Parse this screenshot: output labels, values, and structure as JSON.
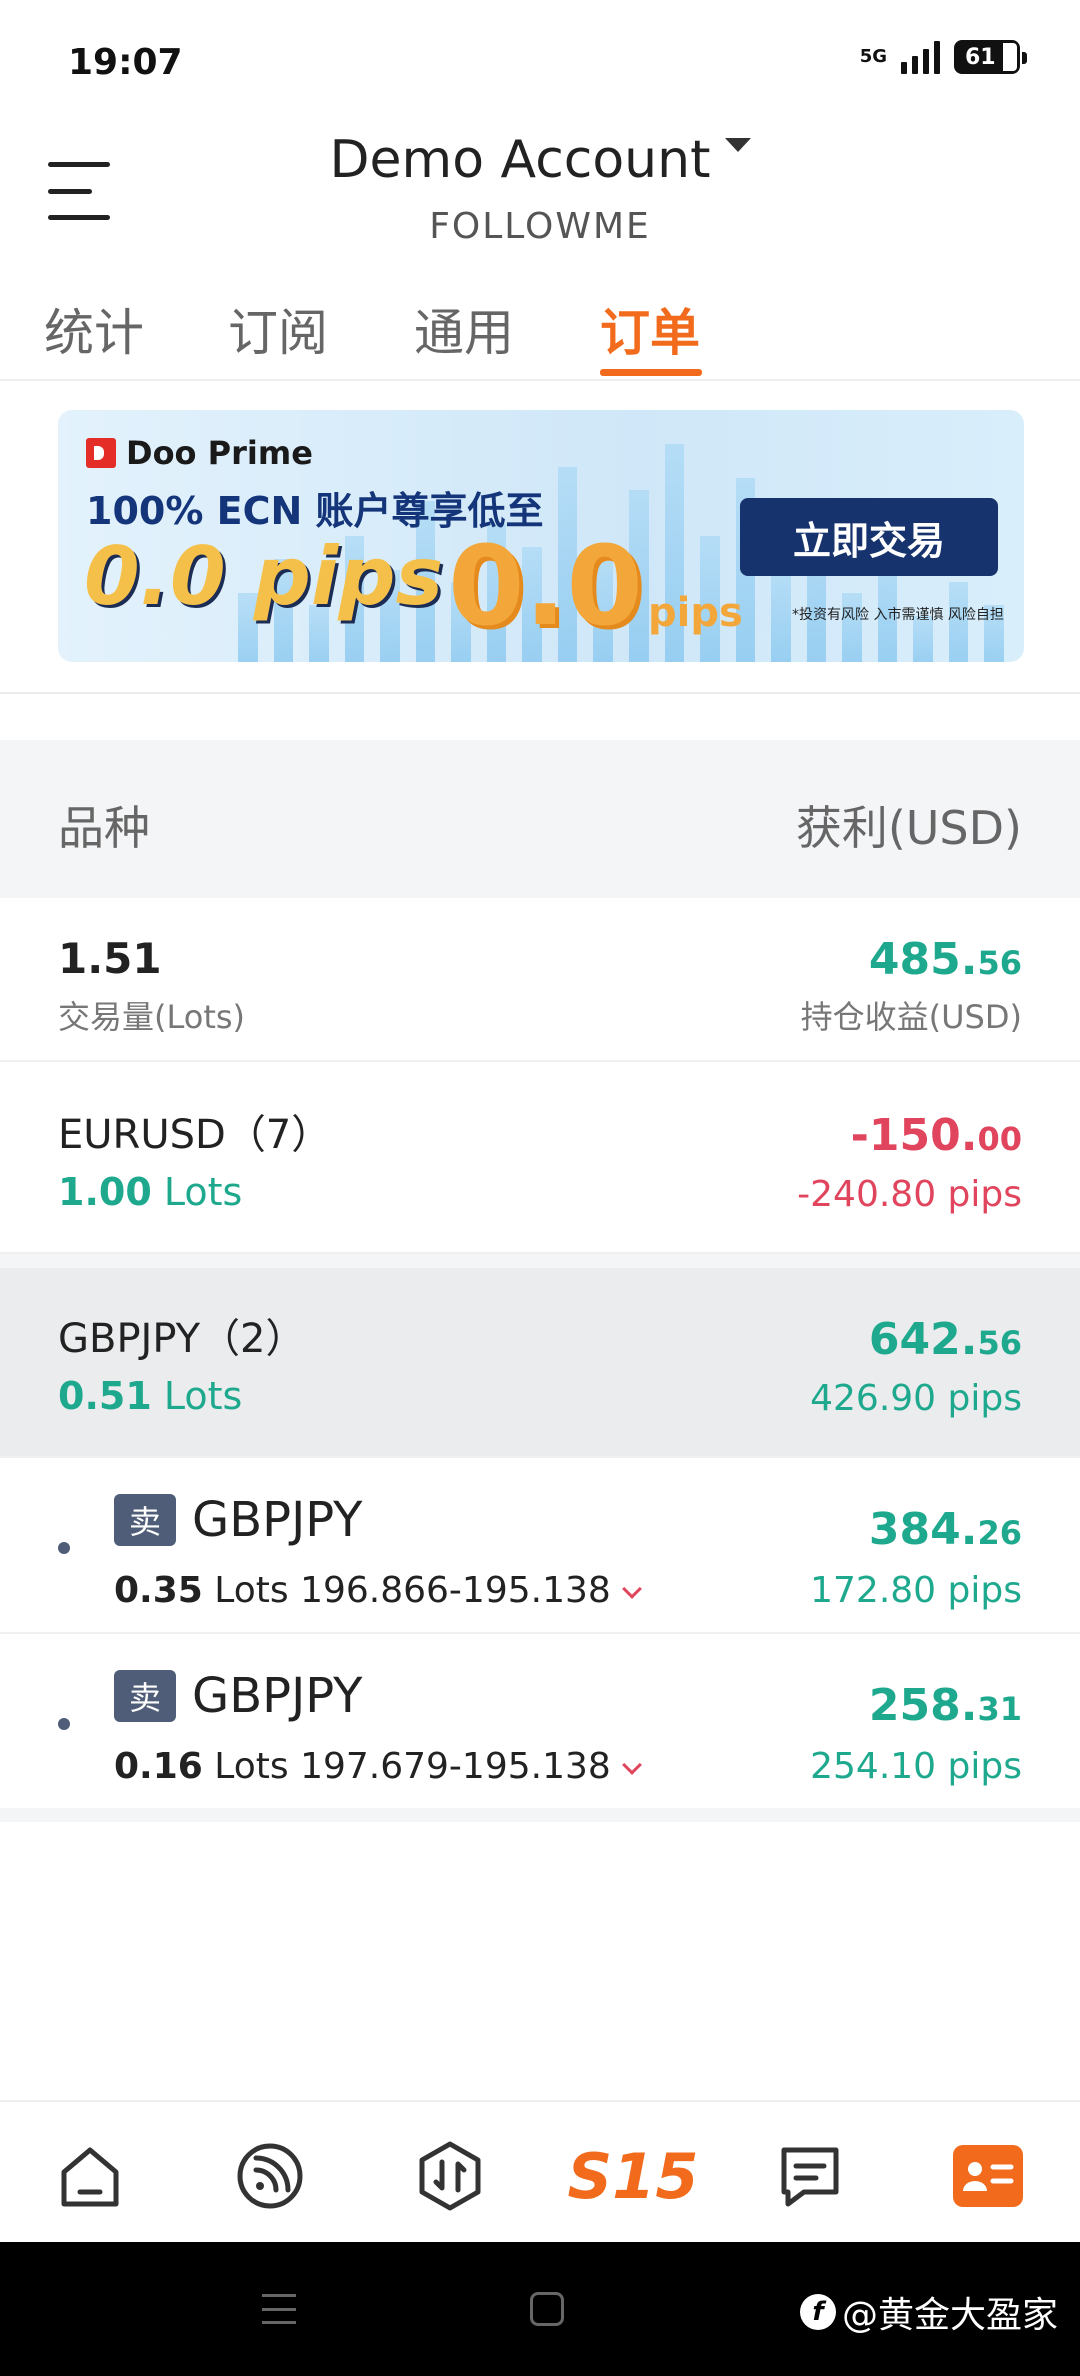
{
  "status_bar": {
    "time": "19:07",
    "network": "5G",
    "battery": "61"
  },
  "header": {
    "account_title": "Demo Account",
    "account_subtitle": "FOLLOWME"
  },
  "tabs": [
    {
      "label": "统计",
      "active": false
    },
    {
      "label": "订阅",
      "active": false
    },
    {
      "label": "通用",
      "active": false
    },
    {
      "label": "订单",
      "active": true
    }
  ],
  "banner": {
    "brand": "Doo Prime",
    "headline": "100% ECN 账户尊享低至",
    "big_text": "0.0 pips",
    "zero_text": "0.0",
    "pips_small": "pips",
    "cta_label": "立即交易",
    "disclaimer": "*投资有风险 入市需谨慎 风险自担"
  },
  "table_header": {
    "left": "品种",
    "right": "获利(USD)"
  },
  "summary": {
    "volume": "1.51",
    "volume_label": "交易量(Lots)",
    "profit_int": "485.",
    "profit_dec": "56",
    "profit_label": "持仓收益(USD)"
  },
  "groups": [
    {
      "symbol": "EURUSD（7）",
      "lots_value": "1.00",
      "lots_unit": "Lots",
      "profit_int": "-150.",
      "profit_dec": "00",
      "pips": "-240.80 pips",
      "positive": false
    },
    {
      "symbol": "GBPJPY（2）",
      "lots_value": "0.51",
      "lots_unit": "Lots",
      "profit_int": "642.",
      "profit_dec": "56",
      "pips": "426.90 pips",
      "positive": true
    }
  ],
  "positions": [
    {
      "side": "卖",
      "symbol": "GBPJPY",
      "lots_value": "0.35",
      "lots_unit": "Lots",
      "prices": "196.866-195.138",
      "profit_int": "384.",
      "profit_dec": "26",
      "pips": "172.80 pips"
    },
    {
      "side": "卖",
      "symbol": "GBPJPY",
      "lots_value": "0.16",
      "lots_unit": "Lots",
      "prices": "197.679-195.138",
      "profit_int": "258.",
      "profit_dec": "31",
      "pips": "254.10 pips"
    }
  ],
  "bottom_nav": {
    "s15_label": "S15"
  },
  "watermark": {
    "text": "@黄金大盈家"
  },
  "colors": {
    "accent": "#f26b1d",
    "profit_green": "#1ea98e",
    "loss_red": "#e0455d",
    "badge": "#4f5d78",
    "banner_cta": "#17336e"
  }
}
